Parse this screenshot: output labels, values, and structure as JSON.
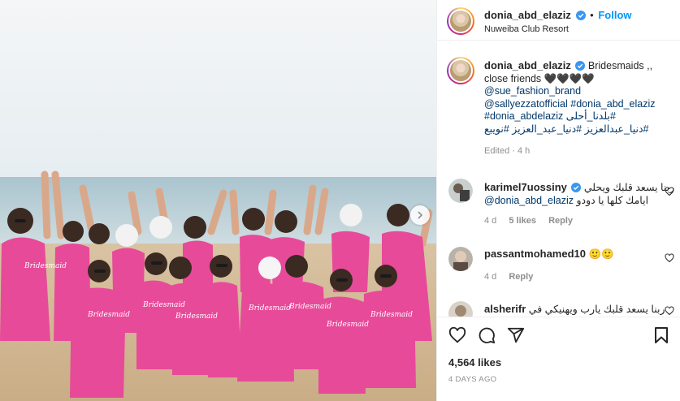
{
  "post": {
    "author": "donia_abd_elaziz",
    "location": "Nuweiba Club Resort",
    "follow_label": "Follow",
    "more_icon": "ellipsis-icon"
  },
  "caption": {
    "username": "donia_abd_elaziz",
    "text_line1": "Bridesmaids ,,",
    "text_line2": "close friends 🖤🖤🖤🖤",
    "mention1": "@sue_fashion_brand",
    "mention2": "@sallyezzatofficial",
    "hashtag1": "#donia_abd_elaziz",
    "hashtag2": "#donia_abdelaziz",
    "arabic_tag1": "#بلدنا_أحلى",
    "arabic_line": "#دنيا_عبدالعزيز #دنيا_عبد_العزيز #نويبع",
    "time": "Edited · 4 h"
  },
  "comments": [
    {
      "username": "karimel7uossiny",
      "verified": true,
      "text_rtl": "ربنا يسعد قلبك ويحلي",
      "text_line2_rtl": "ايامك كلها يا دودو",
      "mention": "@donia_abd_elaziz",
      "time": "4 d",
      "likes": "5 likes",
      "reply": "Reply"
    },
    {
      "username": "passantmohamed10",
      "verified": false,
      "text": "🙂🙂",
      "time": "4 d",
      "reply": "Reply"
    },
    {
      "username": "alsherifr",
      "verified": false,
      "text_rtl": "ربنا يسعد قلبك يارب ويهنيكي في"
    }
  ],
  "footer": {
    "likes": "4,564 likes",
    "date": "4 DAYS AGO"
  },
  "colors": {
    "accent": "#0095f6",
    "verified": "#3897f0",
    "link": "#00376b",
    "muted": "#8e8e8e",
    "dress_pink": "#e84a9a"
  }
}
